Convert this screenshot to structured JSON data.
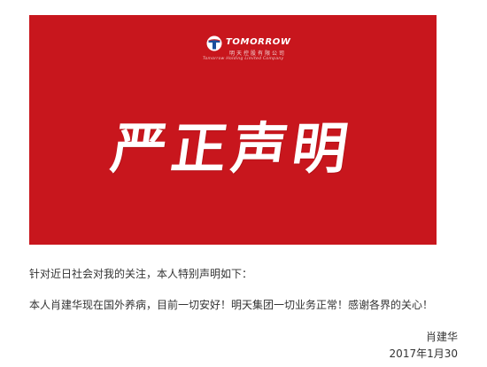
{
  "banner": {
    "background_color": "#c8161d",
    "logo": {
      "name": "TOMORROW",
      "name_cn": "明天控股有限公司",
      "name_en": "Tomorrow Holding Limited Company"
    },
    "headline": "严正声明"
  },
  "body": {
    "line1": "针对近日社会对我的关注，本人特别声明如下：",
    "line2": "本人肖建华现在国外养病，目前一切安好！明天集团一切业务正常！感谢各界的关心！"
  },
  "signature": {
    "name": "肖建华",
    "date": "2017年1月30"
  }
}
